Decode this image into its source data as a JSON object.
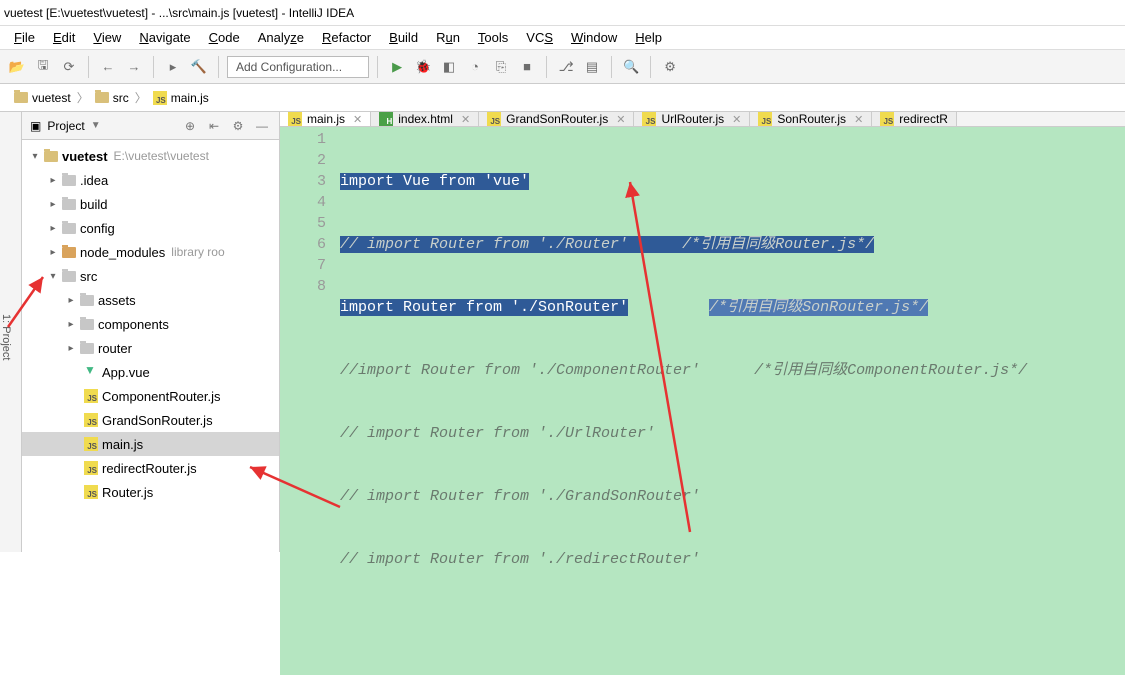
{
  "window_title": "vuetest [E:\\vuetest\\vuetest] - ...\\src\\main.js [vuetest] - IntelliJ IDEA",
  "menu": [
    "File",
    "Edit",
    "View",
    "Navigate",
    "Code",
    "Analyze",
    "Refactor",
    "Build",
    "Run",
    "Tools",
    "VCS",
    "Window",
    "Help"
  ],
  "toolbar": {
    "add_config": "Add Configuration..."
  },
  "breadcrumb": {
    "project": "vuetest",
    "folder": "src",
    "file": "main.js"
  },
  "sidebar_tab_label": "1: Project",
  "project_panel": {
    "title": "Project",
    "root": {
      "name": "vuetest",
      "location": "E:\\vuetest\\vuetest"
    }
  },
  "tree": {
    "idea": ".idea",
    "build": "build",
    "config": "config",
    "node_modules": "node_modules",
    "node_modules_suffix": "library roo",
    "src": "src",
    "assets": "assets",
    "components": "components",
    "router": "router",
    "app_vue": "App.vue",
    "component_router": "ComponentRouter.js",
    "grandson": "GrandSonRouter.js",
    "main_js": "main.js",
    "redirect": "redirectRouter.js",
    "router_js": "Router.js"
  },
  "tabs": [
    "main.js",
    "index.html",
    "GrandSonRouter.js",
    "UrlRouter.js",
    "SonRouter.js",
    "redirectR"
  ],
  "code": {
    "line_count": 8,
    "l1_a": "import",
    "l1_b": " Vue ",
    "l1_c": "from",
    "l1_d": " 'vue'",
    "l2_a": "// import Router from './Router'      ",
    "l2_b": "/*引用自同级Router.js*/",
    "l3_a": "import",
    "l3_b": " Router ",
    "l3_c": "from",
    "l3_d": " './SonRouter'",
    "l3_pad": "         ",
    "l3_e": "/*引用自同级SonRouter.js*/",
    "l4": "//import Router from './ComponentRouter'      /*引用自同级ComponentRouter.js*/",
    "l5": "// import Router from './UrlRouter'",
    "l6": "// import Router from './GrandSonRouter'",
    "l7": "// import Router from './redirectRouter'"
  }
}
